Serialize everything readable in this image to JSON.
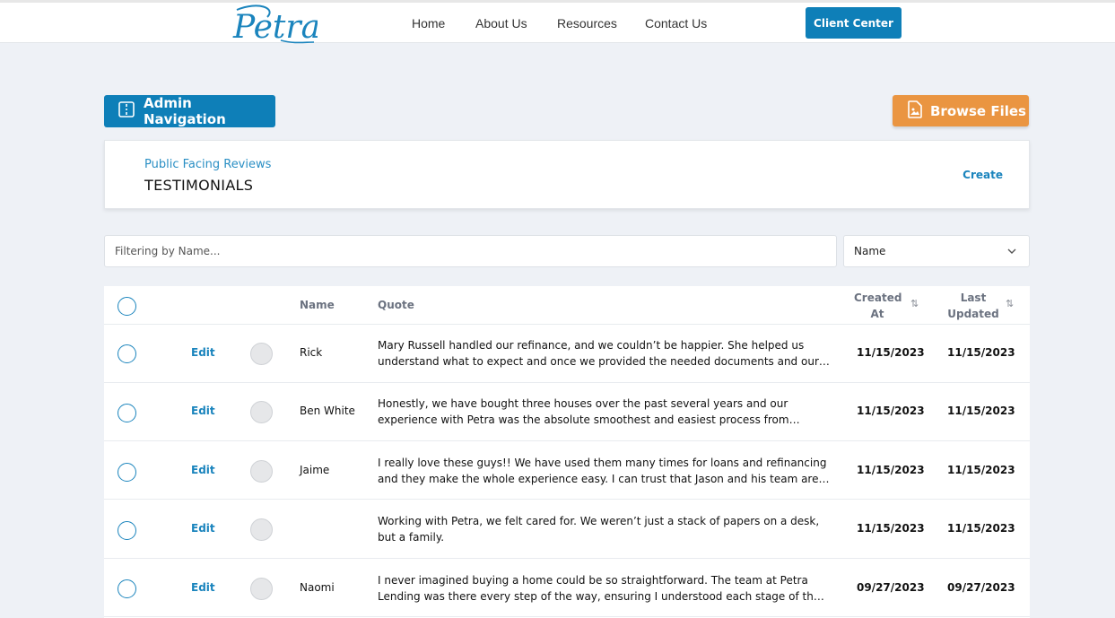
{
  "nav": {
    "logo_text": "Petra",
    "links": [
      "Home",
      "About Us",
      "Resources",
      "Contact Us"
    ],
    "client_center": "Client Center"
  },
  "actions": {
    "admin_navigation": "Admin Navigation",
    "browse_files": "Browse Files"
  },
  "header": {
    "subtitle": "Public Facing Reviews",
    "title": "TESTIMONIALS",
    "create": "Create"
  },
  "filter": {
    "placeholder": "Filtering by Name...",
    "selected": "Name"
  },
  "table": {
    "columns": {
      "name": "Name",
      "quote": "Quote",
      "created_at": "Created At",
      "last_updated": "Last Updated"
    },
    "edit_label": "Edit",
    "rows": [
      {
        "name": "Rick",
        "quote": "Mary Russell handled our refinance, and we couldn’t be happier. She helped us understand what to expect and once we provided the needed documents and our…",
        "created": "11/15/2023",
        "updated": "11/15/2023"
      },
      {
        "name": "Ben White",
        "quote": "Honestly, we have bought three houses over the past several years and our experience with Petra was the absolute smoothest and easiest process from beginning to end. So, …",
        "created": "11/15/2023",
        "updated": "11/15/2023"
      },
      {
        "name": "Jaime",
        "quote": "I really love these guys!! We have used them many times for loans and refinancing and they make the whole experience easy. I can trust that Jason and his team are always…",
        "created": "11/15/2023",
        "updated": "11/15/2023"
      },
      {
        "name": "",
        "quote": "Working with Petra, we felt cared for. We weren’t just a stack of papers on a desk, but a family.",
        "created": "11/15/2023",
        "updated": "11/15/2023"
      },
      {
        "name": "Naomi",
        "quote": "I never imagined buying a home could be so straightforward. The team at Petra Lending was there every step of the way, ensuring I understood each stage of the process. Thei…",
        "created": "09/27/2023",
        "updated": "09/27/2023"
      }
    ]
  },
  "colors": {
    "primary": "#0e7fb8",
    "accent": "#ea9541",
    "background": "#eef1f6"
  },
  "icons": {
    "admin": "sidebar-panel-icon",
    "browse": "file-image-icon",
    "sort": "sort-arrows-icon",
    "select": "chevron-down-icon"
  }
}
